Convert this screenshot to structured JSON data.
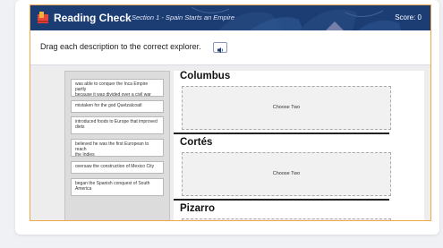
{
  "header": {
    "title": "Reading Check",
    "section": "Section 1 - Spain Starts an Empire",
    "score_label": "Score: 0",
    "background_color": "#1c3d74",
    "logo_icon": "book-flag-icon"
  },
  "instructions": {
    "text": "Drag each description to the correct explorer.",
    "audio_icon": "speaker-icon"
  },
  "cards": [
    {
      "line1": "was able to conquer the Inca Empire partly",
      "line2": "because it was divided over a civil war"
    },
    {
      "line1": "mistaken for the god Quetzalcoatl",
      "line2": ""
    },
    {
      "line1": "introduced foods to Europe that improved",
      "line2": "diets"
    },
    {
      "line1": "believed he was the first European to reach",
      "line2": "the Indies"
    },
    {
      "line1": "oversaw the construction of Mexico City",
      "line2": ""
    },
    {
      "line1": "began the Spanish conquest of South",
      "line2": "America"
    }
  ],
  "explorers": [
    {
      "name": "Columbus",
      "drop_label": "Choose Two"
    },
    {
      "name": "Cortés",
      "drop_label": "Choose Two"
    },
    {
      "name": "Pizarro",
      "drop_label": ""
    }
  ],
  "colors": {
    "frame_border": "#f0a64b",
    "workspace_bg": "#ededed",
    "dropzone_bg": "#f1f1f1"
  }
}
